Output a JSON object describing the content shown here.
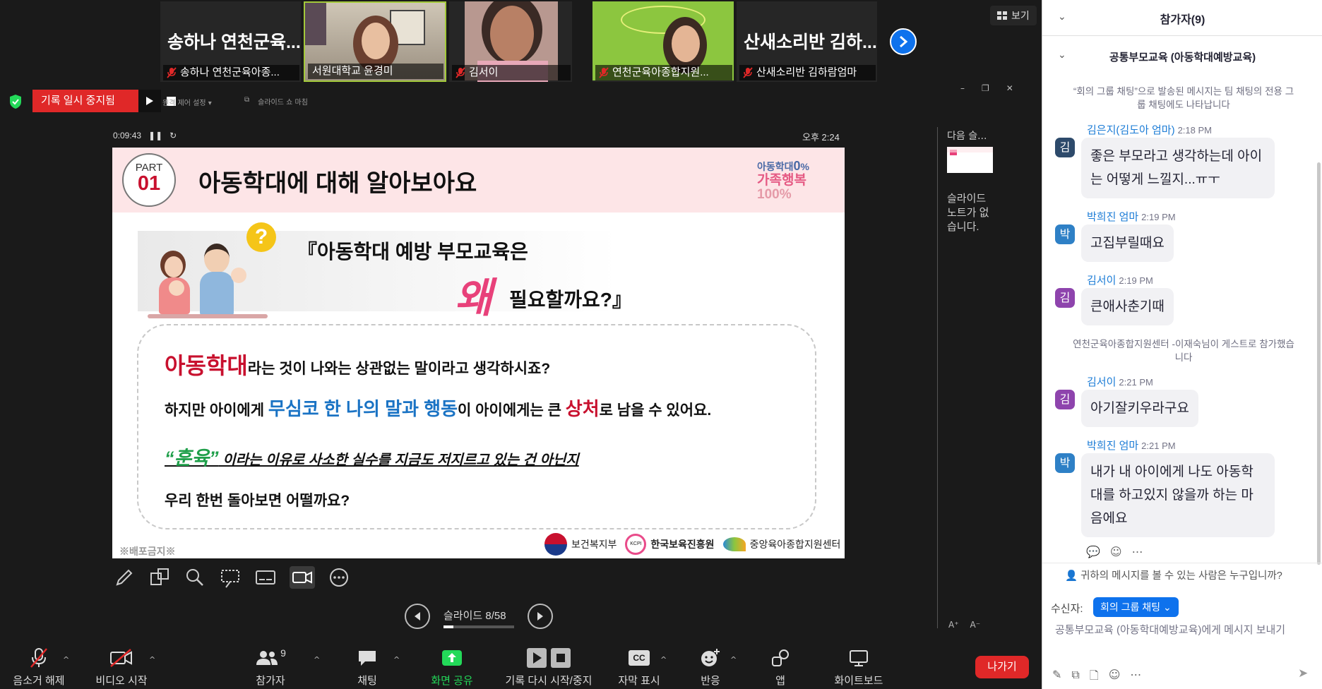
{
  "video_strip": {
    "tiles": [
      {
        "big_name": "송하나 연천군육...",
        "label": "송하나 연천군육아종..."
      },
      {
        "big_name": "",
        "label": "서원대학교 윤경미"
      },
      {
        "big_name": "",
        "label": "김서이"
      },
      {
        "big_name": "",
        "label": "연천군육아종합지원..."
      },
      {
        "big_name": "산새소리반 김하...",
        "label": "산새소리반 김하람엄마"
      }
    ],
    "view_label": "보기"
  },
  "share_bar": {
    "recording_status": "기록 일시 중지됨",
    "remote_setting": "원격 제어 설정",
    "slideshow_label": "슬라이드 쇼 마침",
    "timer": "0:09:43",
    "clock": "오후 2:24"
  },
  "slide": {
    "part_label": "PART",
    "part_number": "01",
    "title": "아동학대에 대해 알아보아요",
    "badge_line1": "아동학대",
    "badge_zero": "0",
    "badge_pct": "%",
    "badge_line2": "가족행복",
    "badge_line3": "100%",
    "question_line1": "『아동학대 예방 부모교육은",
    "question_why": "왜",
    "question_line2": "필요할까요?』",
    "q_mark": "?",
    "line1_highlight": "아동학대",
    "line1_rest": "라는 것이 나와는 상관없는 말이라고 생각하시죠?",
    "line2_a": "하지만 아이에게 ",
    "line2_blue": "무심코 한 나의 말과 행동",
    "line2_b": "이 아이에게는 큰 ",
    "line2_red": "상처",
    "line2_c": "로 남을 수 있어요.",
    "line3_green": "“훈육”",
    "line3_rest": " 이라는 이유로 사소한 실수를 지금도 저지르고 있는 건 아닌지",
    "line4": "우리 한번 돌아보면 어떨까요?",
    "no_distribute": "※배포금지※",
    "logo1": "보건복지부",
    "logo2": "한국보육진흥원",
    "logo2_badge": "KCPI",
    "logo3": "중앙육아종합지원센터"
  },
  "presenter": {
    "next_slide": "다음 슬...",
    "no_notes": "슬라이드 노트가 없습니다.",
    "slide_counter": "슬라이드 8/58",
    "slide_current": 8,
    "slide_total": 58
  },
  "bottom_toolbar": {
    "unmute": "음소거 해제",
    "start_video": "비디오 시작",
    "participants": "참가자",
    "participants_count": "9",
    "chat": "채팅",
    "share_screen": "화면 공유",
    "record": "기록 다시 시작/중지",
    "captions": "자막 표시",
    "captions_icon": "CC",
    "reactions": "반응",
    "apps": "앱",
    "whiteboard": "화이트보드",
    "leave": "나가기"
  },
  "panel": {
    "participants_header": "참가자(9)",
    "chat_header": "공통부모교육 (아동학대예방교육)",
    "system_note": "“회의 그룹 채팅”으로 발송된 메시지는 팀 채팅의 전용 그룹 채팅에도 나타납니다",
    "messages": [
      {
        "avatar": "김",
        "name": "김은지(김도아 엄마)",
        "time": "2:18 PM",
        "text": "좋은 부모라고 생각하는데 아이는 어떻게 느낄지...ㅠㅜ",
        "color": "#2d4a6b"
      },
      {
        "avatar": "박",
        "name": "박희진 엄마",
        "time": "2:19 PM",
        "text": "고집부릴때요",
        "color": "#2e80c6"
      },
      {
        "avatar": "김",
        "name": "김서이",
        "time": "2:19 PM",
        "text": "큰애사춘기때",
        "color": "#8e44ad"
      },
      {
        "avatar": "김",
        "name": "김서이",
        "time": "2:21 PM",
        "text": "아기잘키우라구요",
        "color": "#8e44ad"
      },
      {
        "avatar": "박",
        "name": "박희진 엄마",
        "time": "2:21 PM",
        "text": "내가 내 아이에게 나도 아동학대를 하고있지 않을까 하는 마음에요",
        "color": "#2e80c6"
      }
    ],
    "join_note": "연천군육아종합지원센터 -이재숙님이 게스트로 참가했습니다",
    "who_can_see": "귀하의 메시지를 볼 수 있는 사람은 누구입니까?",
    "recipient_label": "수신자:",
    "recipient_value": "회의 그룹 채팅",
    "input_placeholder": "공통부모교육 (아동학대예방교육)에게 메시지 보내기"
  }
}
